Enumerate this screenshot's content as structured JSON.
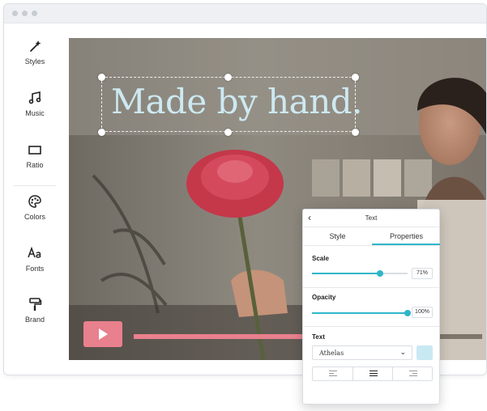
{
  "sidebar": {
    "items": [
      {
        "label": "Styles",
        "icon": "magic-wand-icon"
      },
      {
        "label": "Music",
        "icon": "music-note-icon"
      },
      {
        "label": "Ratio",
        "icon": "ratio-icon"
      },
      {
        "label": "Colors",
        "icon": "palette-icon"
      },
      {
        "label": "Fonts",
        "icon": "font-icon"
      },
      {
        "label": "Brand",
        "icon": "paint-roller-icon"
      }
    ]
  },
  "canvas": {
    "headline": "Made by hand.",
    "progress": 0.55,
    "colors": {
      "text": "#cde9f1",
      "play_button": "#e9808d",
      "progress": "#e9808d"
    }
  },
  "panel": {
    "back_icon": "chevron-left-icon",
    "title": "Text",
    "tabs": [
      {
        "label": "Style",
        "active": false
      },
      {
        "label": "Properties",
        "active": true
      }
    ],
    "scale": {
      "label": "Scale",
      "value": "71%",
      "level": 0.71
    },
    "opacity": {
      "label": "Opacity",
      "value": "100%",
      "level": 1.0
    },
    "text_section": {
      "label": "Text",
      "font": "Athelas",
      "color_swatch": "#c9e9f2",
      "alignments": [
        "align-left-icon",
        "align-center-icon",
        "align-right-icon"
      ],
      "active_alignment": "center"
    },
    "accent": "#2fb6c9"
  }
}
